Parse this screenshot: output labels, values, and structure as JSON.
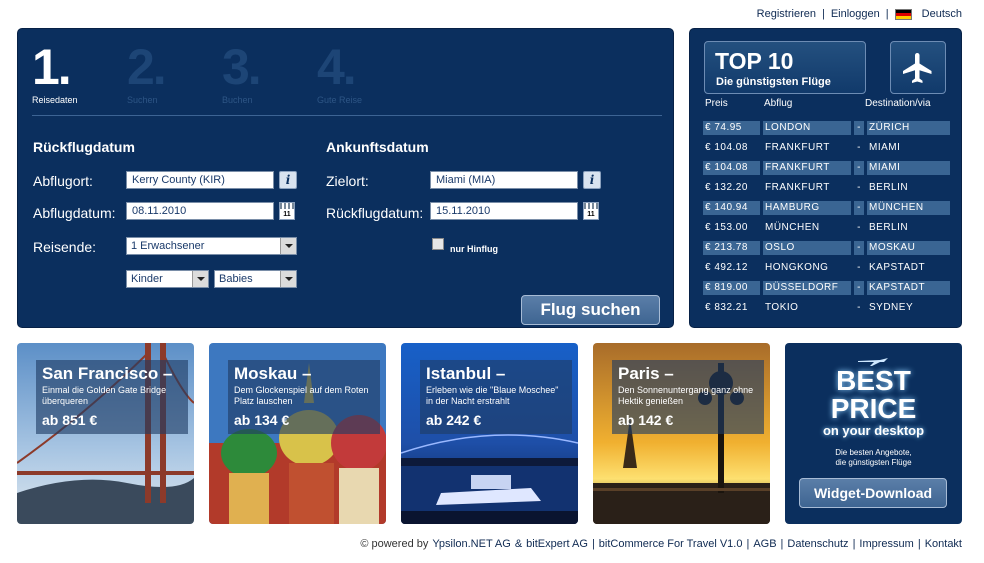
{
  "topnav": {
    "register": "Registrieren",
    "login": "Einloggen",
    "language": "Deutsch"
  },
  "steps": [
    {
      "num": "1.",
      "label": "Reisedaten"
    },
    {
      "num": "2.",
      "label": "Suchen"
    },
    {
      "num": "3.",
      "label": "Buchen"
    },
    {
      "num": "4.",
      "label": "Gute Reise"
    }
  ],
  "form": {
    "left_title": "Rückflugdatum",
    "right_title": "Ankunftsdatum",
    "departure_label": "Abflugort:",
    "departure_value": "Kerry County (KIR)",
    "departure_date_label": "Abflugdatum:",
    "departure_date_value": "08.11.2010",
    "travelers_label": "Reisende:",
    "adults_value": "1 Erwachsener",
    "children_value": "Kinder",
    "babies_value": "Babies",
    "destination_label": "Zielort:",
    "destination_value": "Miami (MIA)",
    "return_date_label": "Rückflugdatum:",
    "return_date_value": "15.11.2010",
    "oneway_label": "nur Hinflug",
    "calendar_day": "11",
    "info_glyph": "i",
    "submit": "Flug suchen"
  },
  "top10": {
    "title": "TOP 10",
    "subtitle": "Die günstigsten Flüge",
    "col_price": "Preis",
    "col_departure": "Abflug",
    "col_destination": "Destination/via",
    "rows": [
      {
        "price": "€ 74.95",
        "from": "LONDON",
        "dash": "-",
        "to": "ZÜRICH",
        "hl": true
      },
      {
        "price": "€ 104.08",
        "from": "FRANKFURT",
        "dash": "-",
        "to": "MIAMI",
        "hl": false
      },
      {
        "price": "€ 104.08",
        "from": "FRANKFURT",
        "dash": "-",
        "to": "MIAMI",
        "hl": true
      },
      {
        "price": "€ 132.20",
        "from": "FRANKFURT",
        "dash": "-",
        "to": "BERLIN",
        "hl": false
      },
      {
        "price": "€ 140.94",
        "from": "HAMBURG",
        "dash": "-",
        "to": "MÜNCHEN",
        "hl": true
      },
      {
        "price": "€ 153.00",
        "from": "MÜNCHEN",
        "dash": "-",
        "to": "BERLIN",
        "hl": false
      },
      {
        "price": "€ 213.78",
        "from": "OSLO",
        "dash": "-",
        "to": "MOSKAU",
        "hl": true
      },
      {
        "price": "€ 492.12",
        "from": "HONGKONG",
        "dash": "-",
        "to": "KAPSTADT",
        "hl": false
      },
      {
        "price": "€ 819.00",
        "from": "DÜSSELDORF",
        "dash": "-",
        "to": "KAPSTADT",
        "hl": true
      },
      {
        "price": "€ 832.21",
        "from": "TOKIO",
        "dash": "-",
        "to": "SYDNEY",
        "hl": false
      }
    ]
  },
  "destinations": [
    {
      "title": "San Francisco –",
      "desc": "Einmal die Golden Gate Bridge überqueren",
      "price": "ab 851 €"
    },
    {
      "title": "Moskau –",
      "desc": "Dem Glockenspiel auf dem Roten Platz lauschen",
      "price": "ab 134 €"
    },
    {
      "title": "Istanbul –",
      "desc": "Erleben wie die \"Blaue Moschee\" in der Nacht erstrahlt",
      "price": "ab 242 €"
    },
    {
      "title": "Paris –",
      "desc": "Den Sonnenuntergang ganz ohne Hektik genießen",
      "price": "ab 142 €"
    }
  ],
  "bestprice": {
    "line1": "BEST",
    "line2": "PRICE",
    "line3": "on your desktop",
    "line4a": "Die besten Angebote,",
    "line4b": "die günstigsten Flüge",
    "button": "Widget-Download"
  },
  "footer": {
    "powered": "© powered by",
    "company1": "Ypsilon.NET AG",
    "amp": "&",
    "company2": "bitExpert AG",
    "product": "bitCommerce For Travel V1.0",
    "agb": "AGB",
    "privacy": "Datenschutz",
    "imprint": "Impressum",
    "contact": "Kontakt"
  }
}
